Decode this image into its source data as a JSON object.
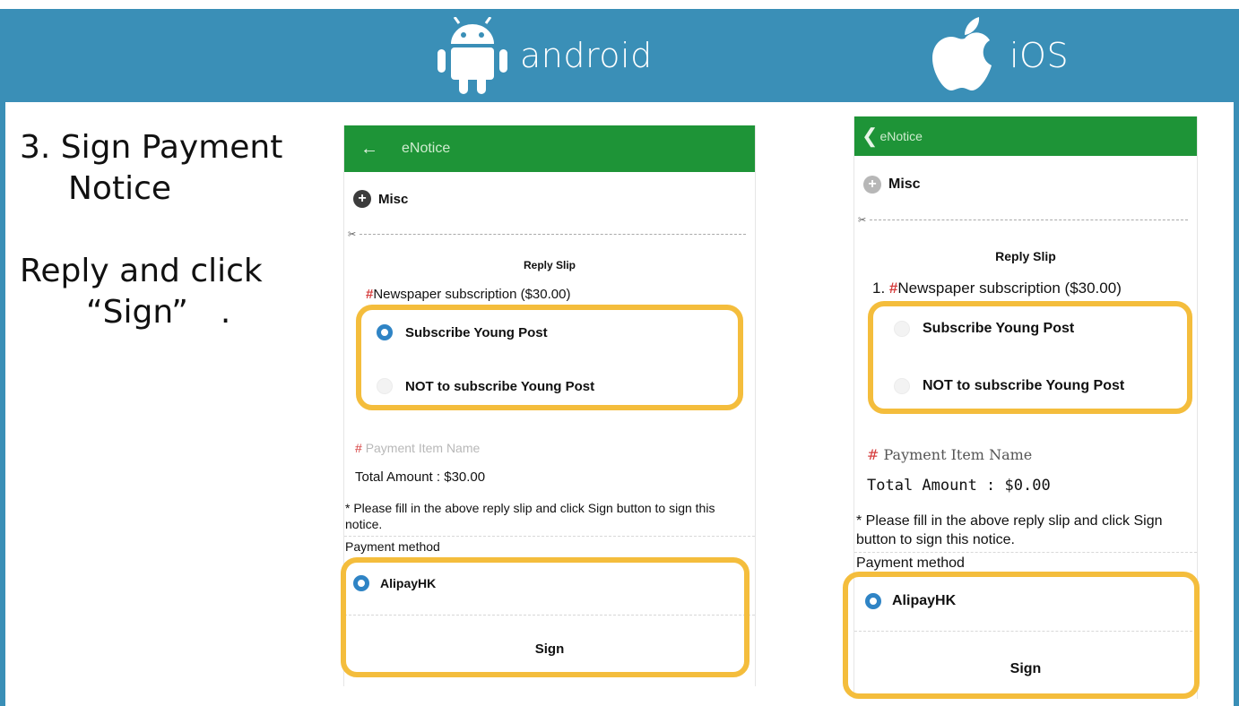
{
  "platforms": {
    "android_label": "android",
    "ios_label": "iOS",
    "android_icon": "android-robot-icon",
    "ios_icon": "apple-logo-icon"
  },
  "step": {
    "title_line1": "3. Sign Payment",
    "title_line2": "Notice",
    "instruction_line1": "Reply and click",
    "instruction_line2": "“Sign”　."
  },
  "colors": {
    "banner": "#3a8fb7",
    "app_bar": "#1e9437",
    "highlight": "#f4bd3c",
    "radio_selected": "#2f84c5"
  },
  "android_app": {
    "back_icon": "←",
    "title": "eNotice",
    "misc_label": "Misc",
    "reply_slip_title": "Reply Slip",
    "question_hash": "#",
    "question": "Newspaper subscription ($30.00)",
    "options": [
      {
        "label": "Subscribe Young Post",
        "selected": true
      },
      {
        "label": "NOT to subscribe Young Post",
        "selected": false
      }
    ],
    "payment_item_hash": "#",
    "payment_item": "Payment Item Name",
    "total_amount": "Total Amount : $30.00",
    "note": "* Please fill in the above reply slip and click Sign button to sign this notice.",
    "payment_method_label": "Payment method",
    "payment_method": "AlipayHK",
    "sign_label": "Sign"
  },
  "ios_app": {
    "back_icon": "❮",
    "title": "eNotice",
    "misc_label": "Misc",
    "reply_slip_title": "Reply Slip",
    "question_number": "1.",
    "question_hash": "#",
    "question": "Newspaper subscription ($30.00)",
    "options": [
      {
        "label": "Subscribe Young Post",
        "selected": false
      },
      {
        "label": "NOT to subscribe Young Post",
        "selected": false
      }
    ],
    "payment_item_hash": "#",
    "payment_item": "Payment Item Name",
    "total_amount": "Total Amount : $0.00",
    "note": "* Please fill in the above reply slip and click Sign button to sign this notice.",
    "payment_method_label": "Payment method",
    "payment_method": "AlipayHK",
    "sign_label": "Sign"
  }
}
